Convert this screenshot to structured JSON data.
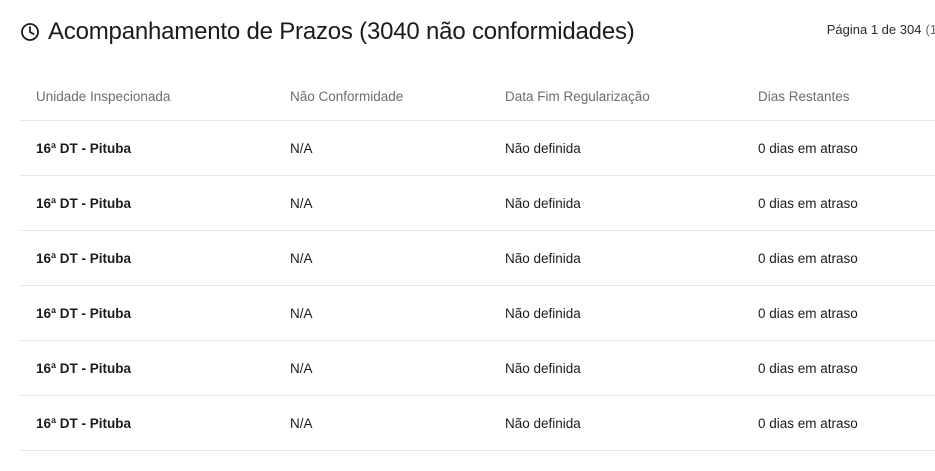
{
  "header": {
    "title": "Acompanhamento de Prazos (3040 não conformidades)",
    "pagination": "Página 1 de 304",
    "pagination_extra": "(1"
  },
  "table": {
    "columns": [
      "Unidade Inspecionada",
      "Não Conformidade",
      "Data Fim Regularização",
      "Dias Restantes"
    ],
    "rows": [
      {
        "unidade": "16ª DT - Pituba",
        "nao_conformidade": "N/A",
        "data_fim": "Não definida",
        "dias": "0 dias em atraso"
      },
      {
        "unidade": "16ª DT - Pituba",
        "nao_conformidade": "N/A",
        "data_fim": "Não definida",
        "dias": "0 dias em atraso"
      },
      {
        "unidade": "16ª DT - Pituba",
        "nao_conformidade": "N/A",
        "data_fim": "Não definida",
        "dias": "0 dias em atraso"
      },
      {
        "unidade": "16ª DT - Pituba",
        "nao_conformidade": "N/A",
        "data_fim": "Não definida",
        "dias": "0 dias em atraso"
      },
      {
        "unidade": "16ª DT - Pituba",
        "nao_conformidade": "N/A",
        "data_fim": "Não definida",
        "dias": "0 dias em atraso"
      },
      {
        "unidade": "16ª DT - Pituba",
        "nao_conformidade": "N/A",
        "data_fim": "Não definida",
        "dias": "0 dias em atraso"
      }
    ]
  },
  "icons": {
    "title_icon": "clock-icon"
  },
  "colors": {
    "text": "#1b1b1b",
    "header_text": "#6d6d6d",
    "divider": "#e6e6e6"
  }
}
